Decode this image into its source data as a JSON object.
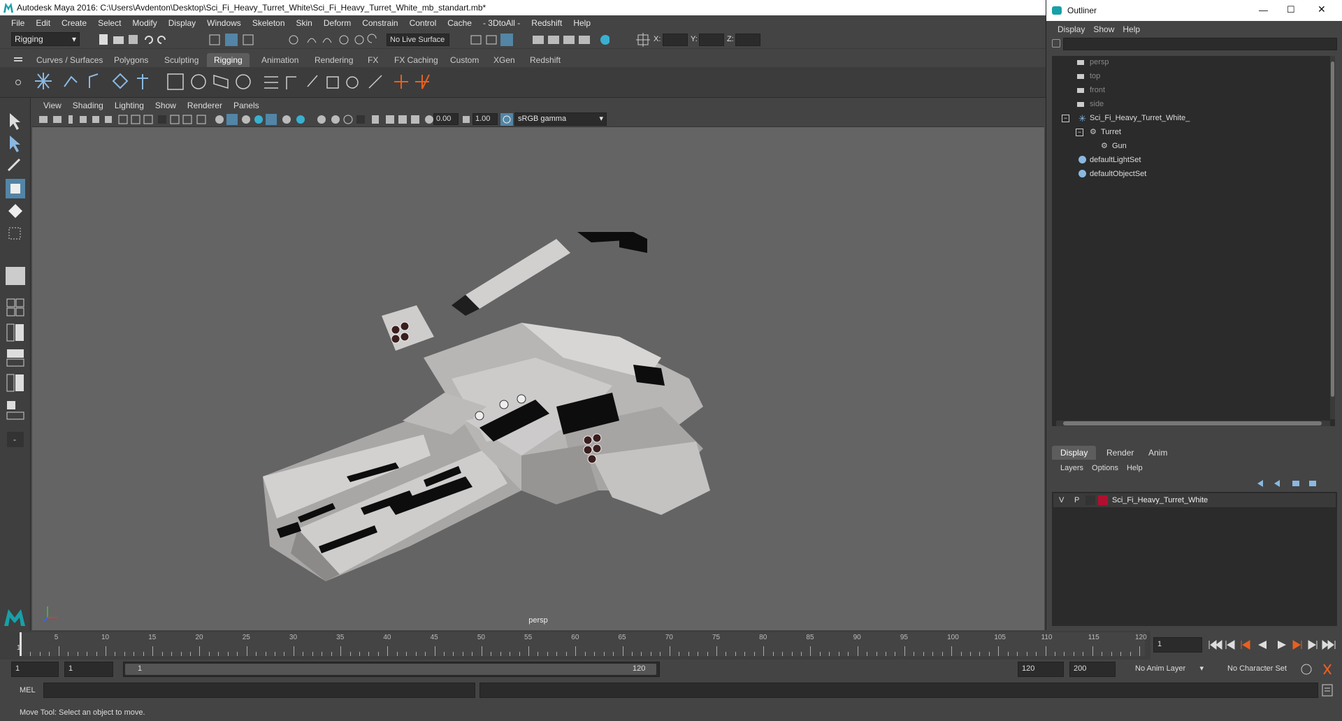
{
  "window_title": "Autodesk Maya 2016: C:\\Users\\Avdenton\\Desktop\\Sci_Fi_Heavy_Turret_White\\Sci_Fi_Heavy_Turret_White_mb_standart.mb*",
  "menus": [
    "File",
    "Edit",
    "Create",
    "Select",
    "Modify",
    "Display",
    "Windows",
    "Skeleton",
    "Skin",
    "Deform",
    "Constrain",
    "Control",
    "Cache",
    "- 3DtoAll -",
    "Redshift",
    "Help"
  ],
  "status": {
    "mode": "Rigging",
    "live_surface": "No Live Surface",
    "x_label": "X:",
    "y_label": "Y:",
    "z_label": "Z:"
  },
  "shelf_tabs": [
    "Curves / Surfaces",
    "Polygons",
    "Sculpting",
    "Rigging",
    "Animation",
    "Rendering",
    "FX",
    "FX Caching",
    "Custom",
    "XGen",
    "Redshift"
  ],
  "active_shelf_tab": "Rigging",
  "panel_menus": [
    "View",
    "Shading",
    "Lighting",
    "Show",
    "Renderer",
    "Panels"
  ],
  "panel_toolbar": {
    "exposure": "0.00",
    "gamma": "1.00",
    "color_space": "sRGB gamma"
  },
  "viewport": {
    "camera_label": "persp"
  },
  "timeline": {
    "ticks": [
      "5",
      "10",
      "15",
      "20",
      "25",
      "30",
      "35",
      "40",
      "45",
      "50",
      "55",
      "60",
      "65",
      "70",
      "75",
      "80",
      "85",
      "90",
      "95",
      "100",
      "105",
      "110",
      "115",
      "120"
    ],
    "current_frame_marker": "1",
    "current_frame_field": "1"
  },
  "range": {
    "start": "1",
    "playback_start": "1",
    "slider_start": "1",
    "slider_end": "120",
    "playback_end": "120",
    "end": "200",
    "anim_layer": "No Anim Layer",
    "character_set": "No Character Set"
  },
  "command": {
    "label": "MEL"
  },
  "help_line": "Move Tool: Select an object to move.",
  "outliner": {
    "title": "Outliner",
    "menus": [
      "Display",
      "Show",
      "Help"
    ],
    "items": [
      "persp",
      "top",
      "front",
      "side",
      "Sci_Fi_Heavy_Turret_White_",
      "Turret",
      "Gun",
      "defaultLightSet",
      "defaultObjectSet"
    ]
  },
  "layer_editor": {
    "tabs": [
      "Display",
      "Render",
      "Anim"
    ],
    "menus": [
      "Layers",
      "Options",
      "Help"
    ],
    "layer": {
      "visible": "V",
      "playback": "P",
      "name": "Sci_Fi_Heavy_Turret_White",
      "color": "#b01030"
    }
  },
  "colors": {
    "accent": "#5285a6",
    "maya_logo": "#18a0a8"
  }
}
